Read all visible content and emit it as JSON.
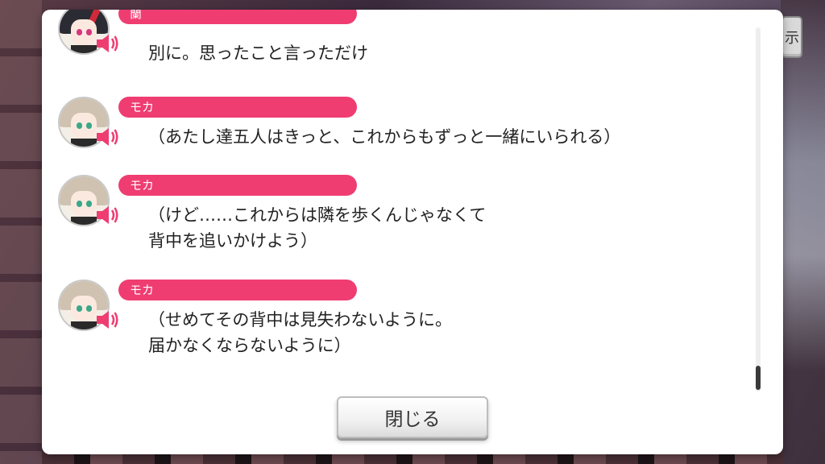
{
  "background": {
    "side_button_glyph": "示"
  },
  "dialog_log": {
    "entries": [
      {
        "speaker": "蘭",
        "character": "ran",
        "text": "別に。思ったこと言っただけ",
        "voice_icon": "speaker-icon"
      },
      {
        "speaker": "モカ",
        "character": "moca",
        "text": "（あたし達五人はきっと、これからもずっと一緒にいられる）",
        "voice_icon": "speaker-icon"
      },
      {
        "speaker": "モカ",
        "character": "moca",
        "text": "（けど……これからは隣を歩くんじゃなくて\n背中を追いかけよう）",
        "voice_icon": "speaker-icon"
      },
      {
        "speaker": "モカ",
        "character": "moca",
        "text": "（せめてその背中は見失わないように。\n届かなくならないように）",
        "voice_icon": "speaker-icon"
      }
    ],
    "close_label": "閉じる"
  },
  "colors": {
    "name_tag": "#ef3d72",
    "speaker_icon": "#ef3d72",
    "panel": "#ffffff"
  }
}
